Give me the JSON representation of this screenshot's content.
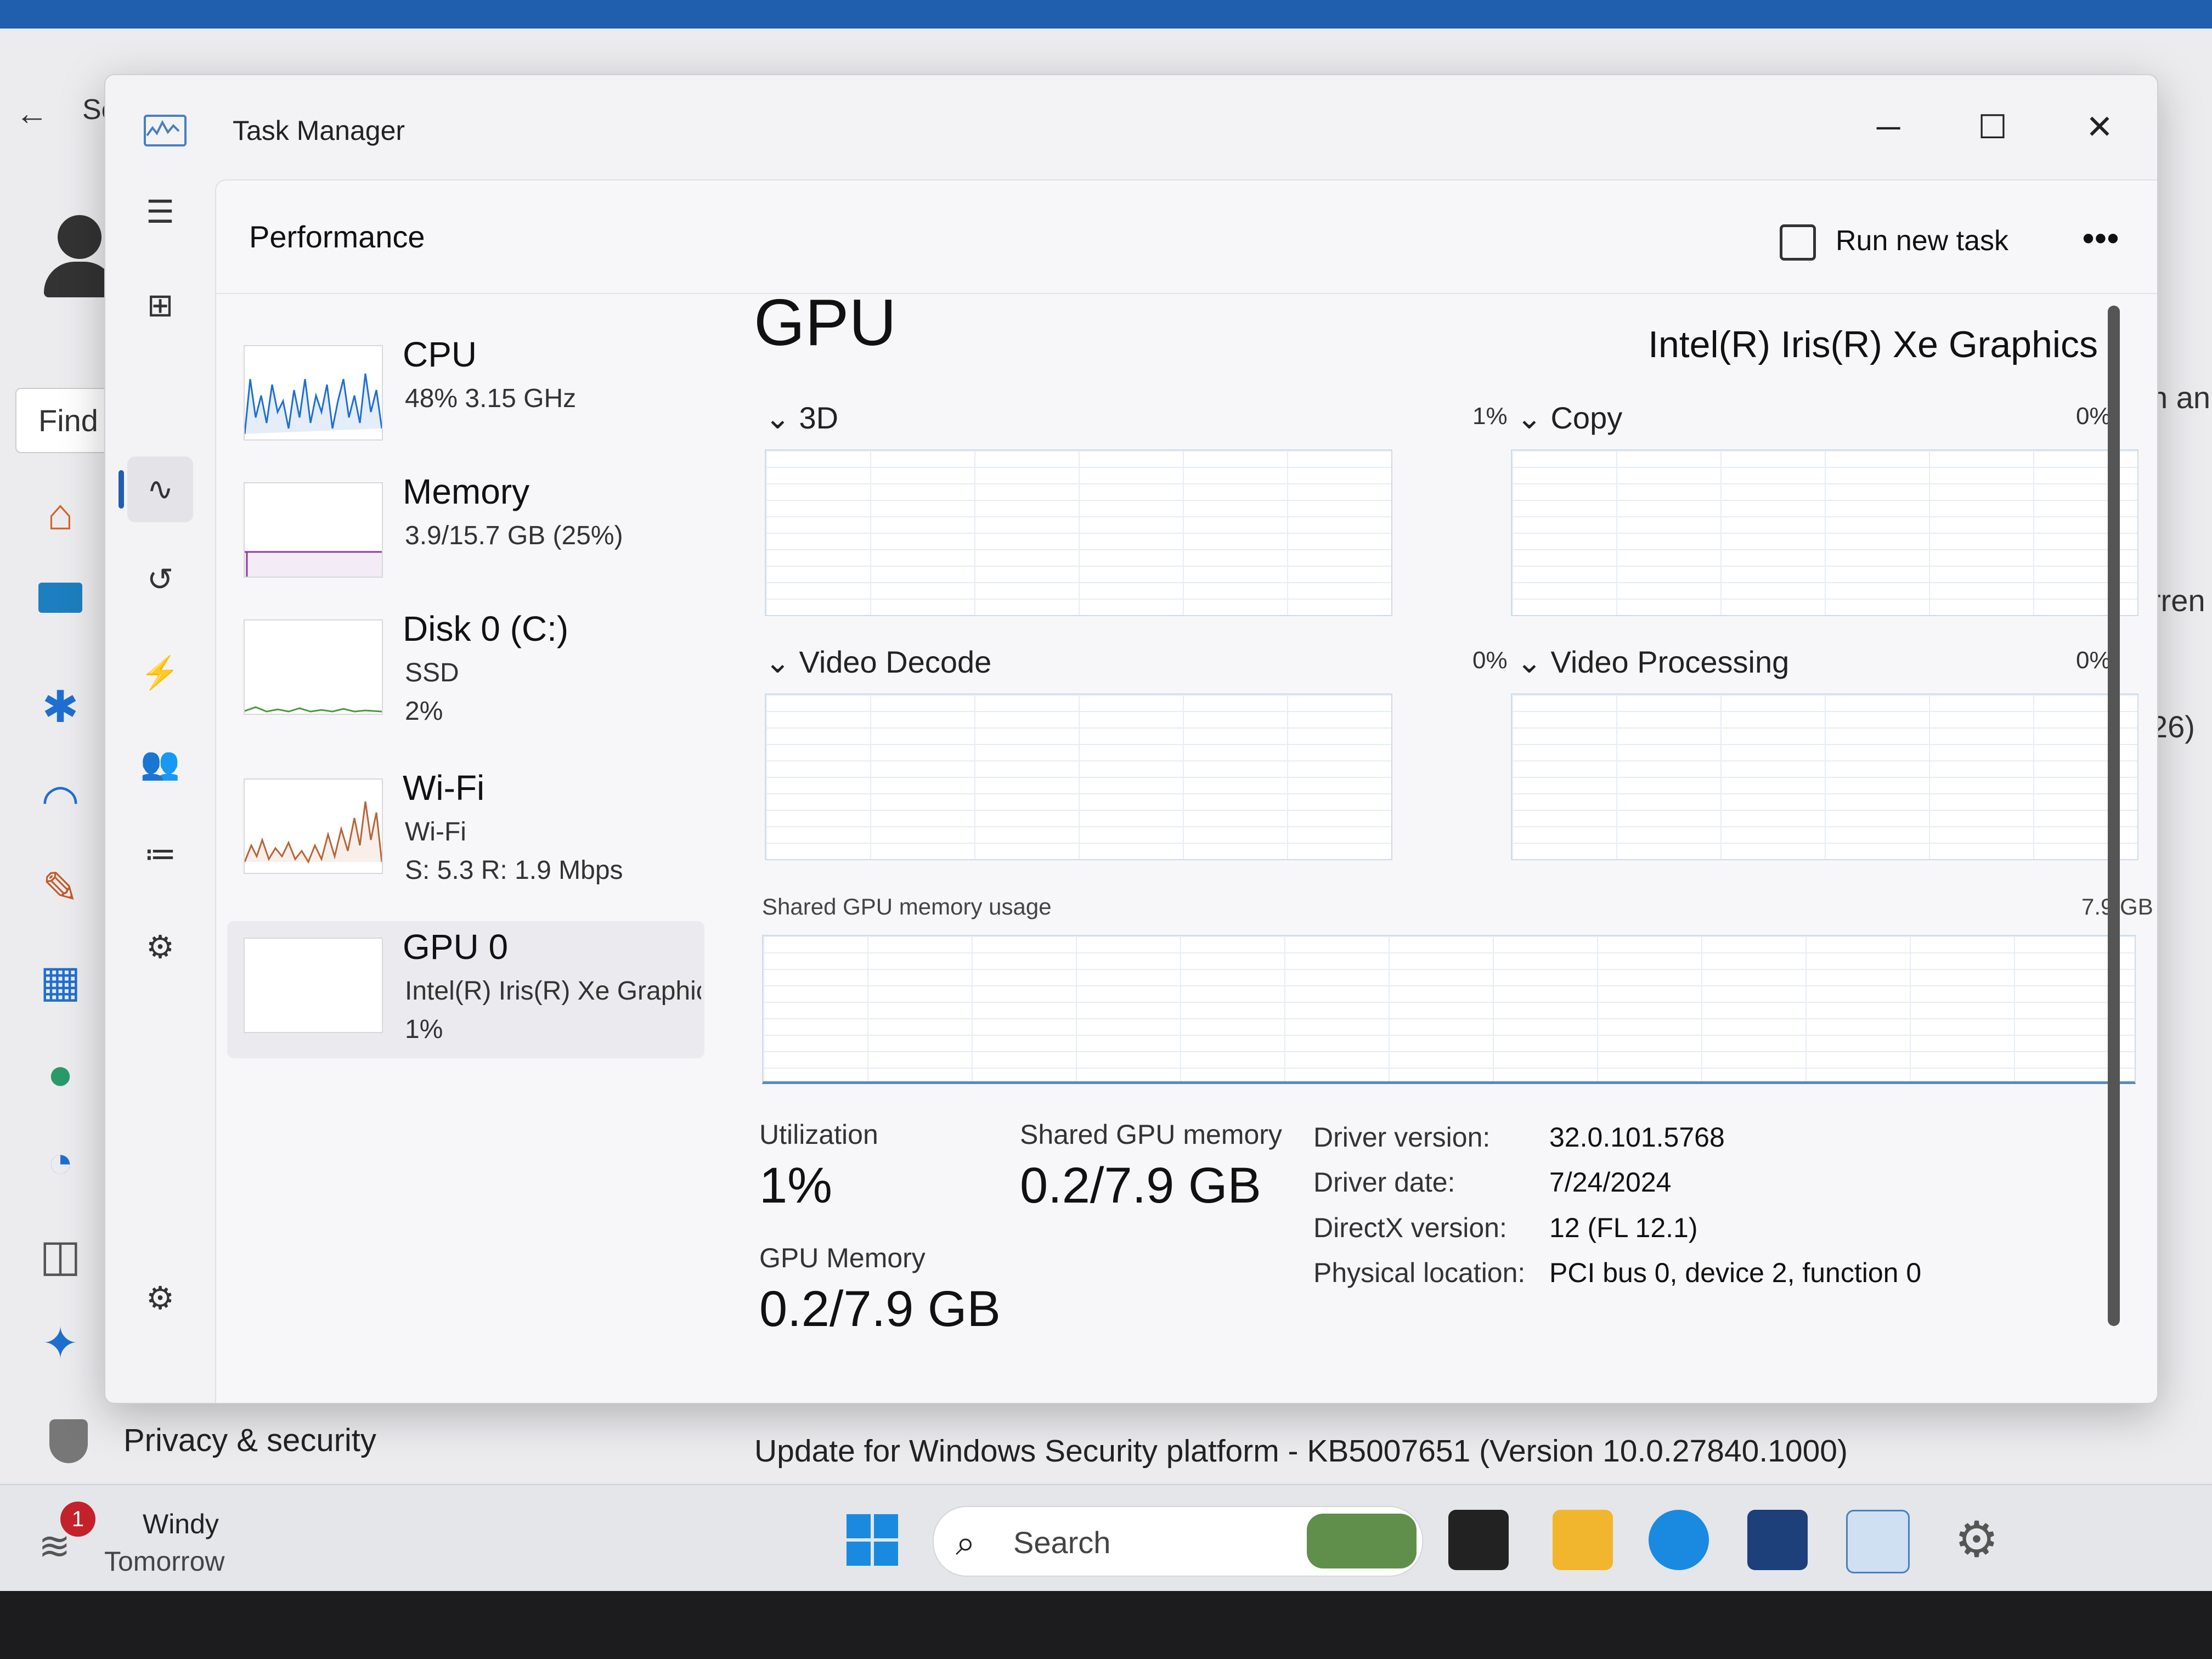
{
  "background": {
    "settings_title_fragment": "Se",
    "find_text": "Find",
    "right_fragments": [
      "n an",
      "rren",
      "26)"
    ],
    "privacy_label": "Privacy & security",
    "update_text": "Update for Windows Security platform - KB5007651 (Version 10.0.27840.1000)"
  },
  "window": {
    "title": "Task Manager",
    "minimize": "─",
    "maximize": "☐",
    "close": "✕"
  },
  "header": {
    "page_title": "Performance",
    "run_new_task": "Run new task",
    "more": "•••"
  },
  "devices": [
    {
      "name": "CPU",
      "sub1": "48%  3.15 GHz",
      "sub2": ""
    },
    {
      "name": "Memory",
      "sub1": "3.9/15.7 GB (25%)",
      "sub2": ""
    },
    {
      "name": "Disk 0 (C:)",
      "sub1": "SSD",
      "sub2": "2%"
    },
    {
      "name": "Wi-Fi",
      "sub1": "Wi-Fi",
      "sub2": "S: 5.3  R: 1.9 Mbps"
    },
    {
      "name": "GPU 0",
      "sub1": "Intel(R) Iris(R) Xe Graphics",
      "sub2": "1%"
    }
  ],
  "gpu": {
    "heading": "GPU",
    "model": "Intel(R) Iris(R) Xe Graphics",
    "engines": [
      {
        "label": "3D",
        "pct": "1%"
      },
      {
        "label": "Copy",
        "pct": "0%"
      },
      {
        "label": "Video Decode",
        "pct": "0%"
      },
      {
        "label": "Video Processing",
        "pct": "0%"
      }
    ],
    "shared_usage_label": "Shared GPU memory usage",
    "shared_usage_max": "7.9 GB",
    "stats": {
      "utilization_label": "Utilization",
      "utilization_value": "1%",
      "shared_label": "Shared GPU memory",
      "shared_value": "0.2/7.9 GB",
      "gpu_mem_label": "GPU Memory",
      "gpu_mem_value": "0.2/7.9 GB"
    },
    "info": [
      {
        "key": "Driver version:",
        "value": "32.0.101.5768"
      },
      {
        "key": "Driver date:",
        "value": "7/24/2024"
      },
      {
        "key": "DirectX version:",
        "value": "12 (FL 12.1)"
      },
      {
        "key": "Physical location:",
        "value": "PCI bus 0, device 2, function 0"
      }
    ]
  },
  "taskbar": {
    "weather_badge": "1",
    "weather_title": "Windy",
    "weather_sub": "Tomorrow",
    "search_placeholder": "Search"
  },
  "colors": {
    "accent": "#1f5fae",
    "cpu_line": "#1f6fd0",
    "memory_line": "#8b3fa0",
    "disk_line": "#4a9a3a",
    "wifi_line": "#b8643a"
  }
}
